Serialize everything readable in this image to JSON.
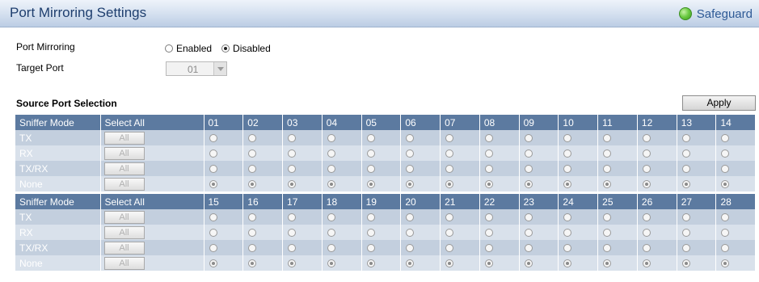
{
  "header": {
    "title": "Port Mirroring Settings",
    "safeguard_label": "Safeguard",
    "safeguard_status_color": "#69c940"
  },
  "settings": {
    "port_mirroring_label": "Port Mirroring",
    "enabled_label": "Enabled",
    "disabled_label": "Disabled",
    "selected": "Disabled",
    "target_port_label": "Target Port",
    "target_port_value": "01"
  },
  "source": {
    "section_title": "Source Port Selection",
    "apply_label": "Apply",
    "col_mode": "Sniffer Mode",
    "col_select_all": "Select All",
    "all_label": "All",
    "modes": [
      "TX",
      "RX",
      "TX/RX",
      "None"
    ],
    "selected_mode": "None",
    "groups": [
      {
        "ports": [
          "01",
          "02",
          "03",
          "04",
          "05",
          "06",
          "07",
          "08",
          "09",
          "10",
          "11",
          "12",
          "13",
          "14"
        ]
      },
      {
        "ports": [
          "15",
          "16",
          "17",
          "18",
          "19",
          "20",
          "21",
          "22",
          "23",
          "24",
          "25",
          "26",
          "27",
          "28"
        ]
      }
    ]
  },
  "colors": {
    "header_blue": "#1e3e6e",
    "table_header": "#5c7aa0",
    "row_odd": "#c3cfde",
    "row_even": "#d9e1eb"
  }
}
